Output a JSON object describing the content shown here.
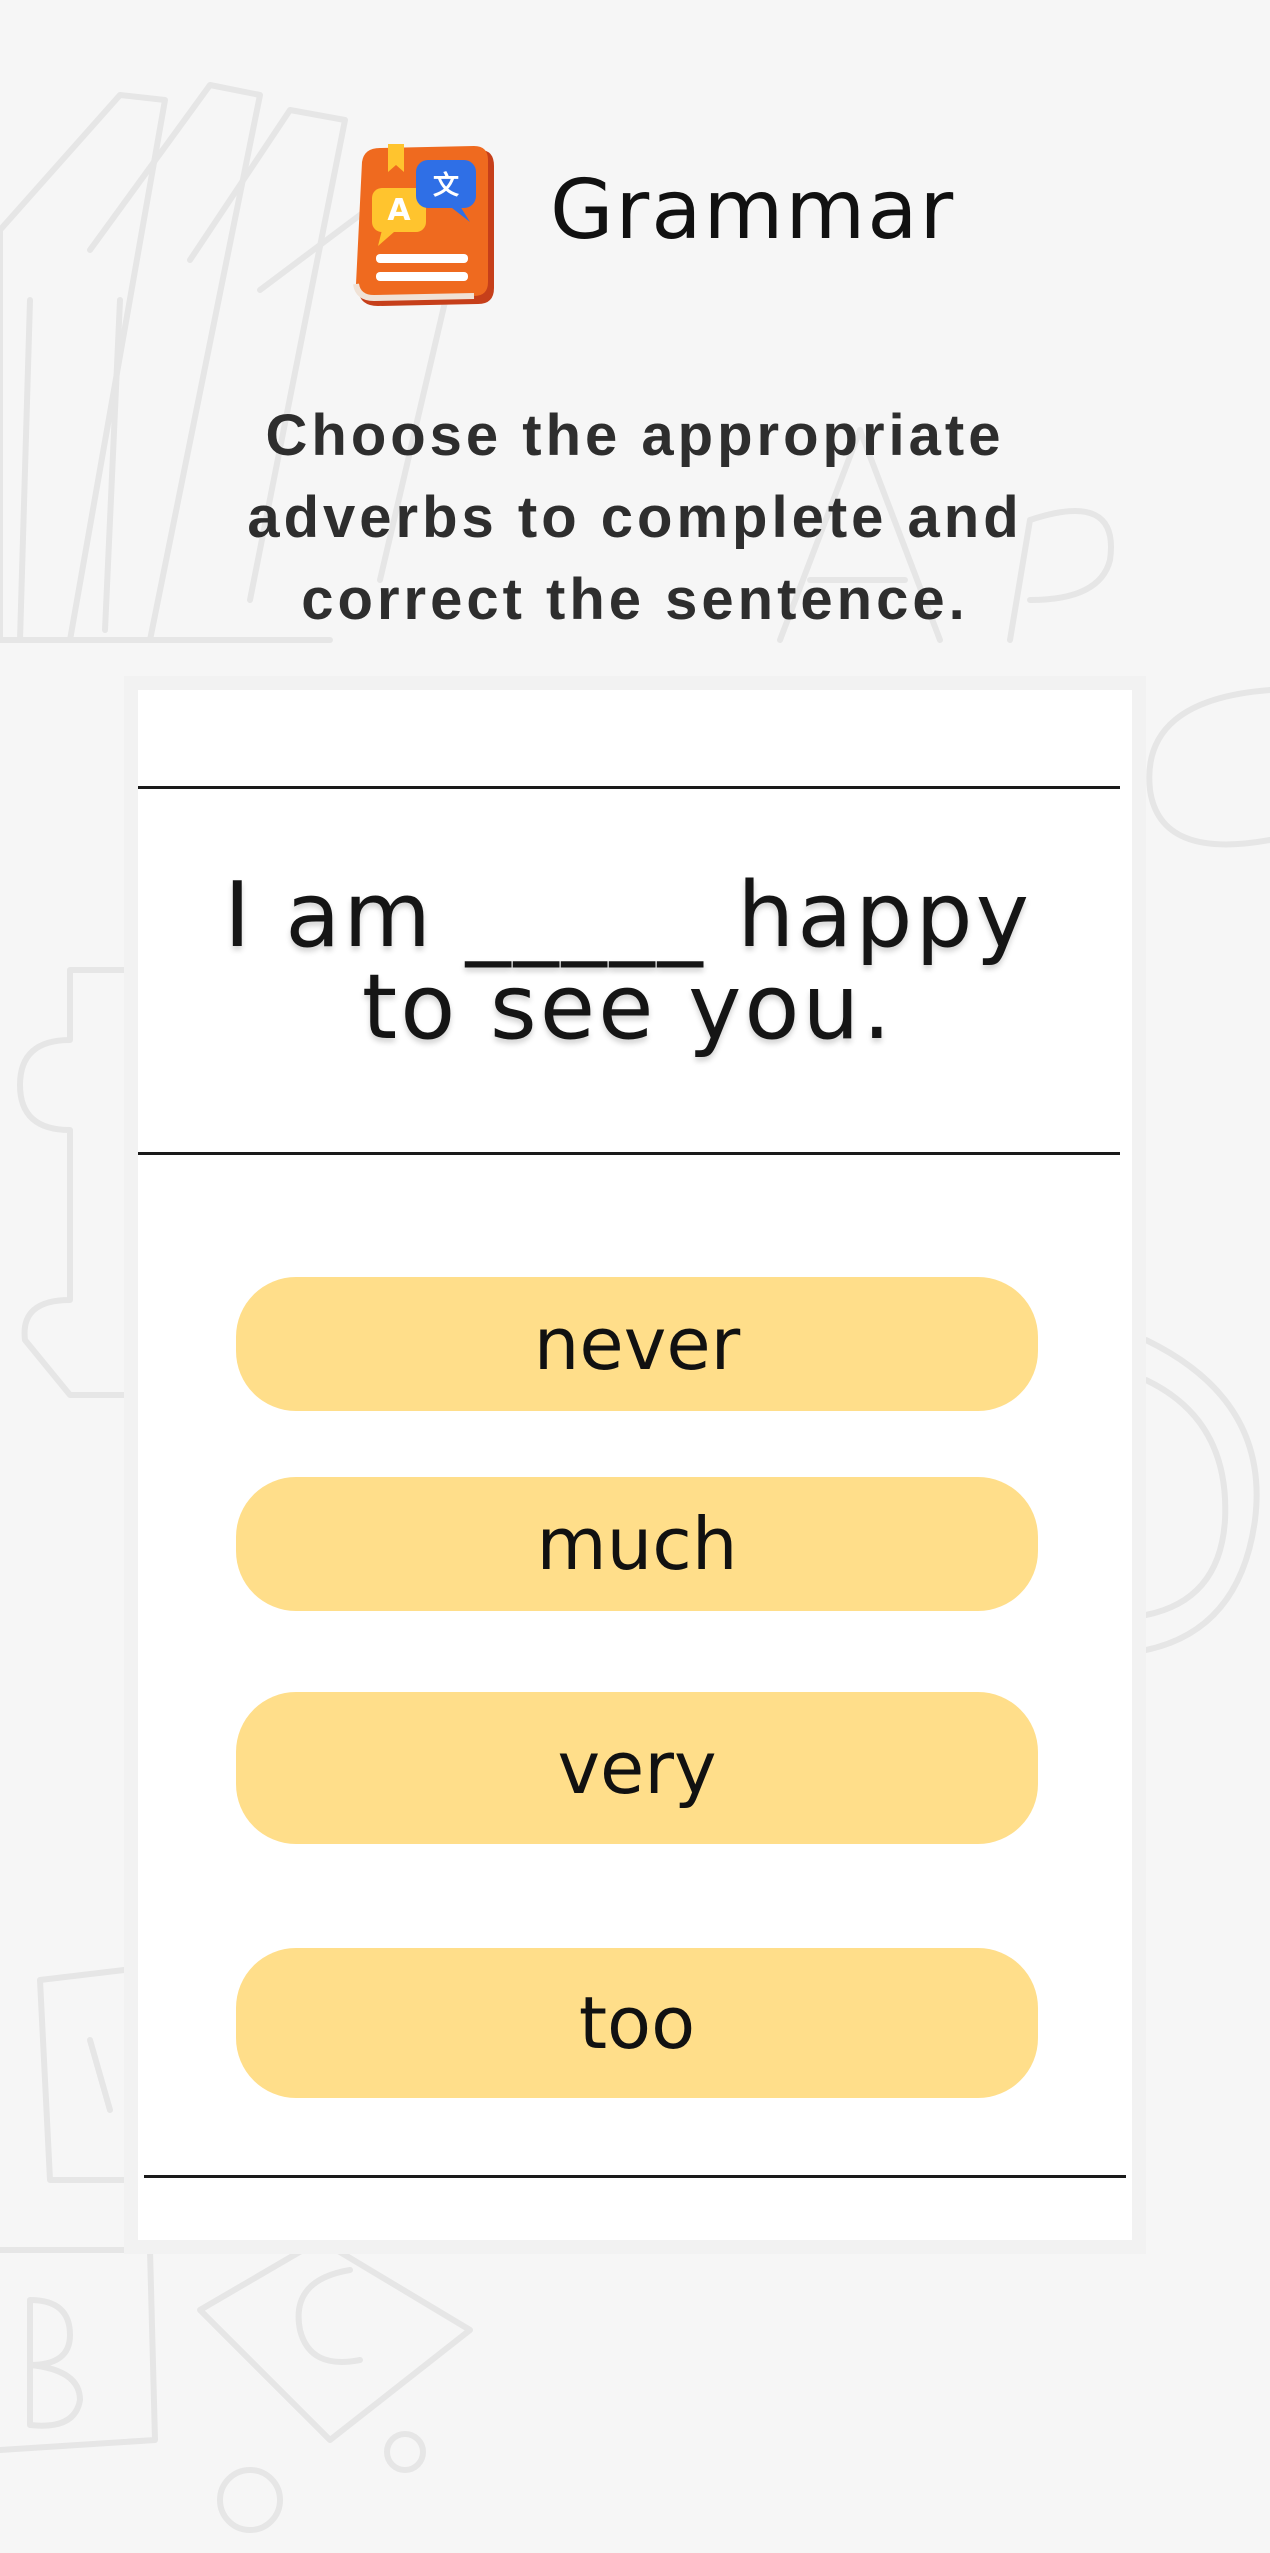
{
  "header": {
    "title": "Grammar",
    "icon": "grammar-book-icon"
  },
  "instructions": {
    "line1": "Choose the appropriate",
    "line2": "adverbs to complete and",
    "line3": "correct the sentence."
  },
  "question": {
    "line1": "I am _____ happy",
    "line2": "to see you."
  },
  "options": [
    {
      "label": "never"
    },
    {
      "label": "much"
    },
    {
      "label": "very"
    },
    {
      "label": "too"
    }
  ],
  "colors": {
    "background": "#f6f6f6",
    "card": "#ffffff",
    "option": "#ffde8a",
    "icon_orange": "#ef6a1f",
    "icon_blue": "#2f6fe6",
    "icon_yellow": "#ffc42e"
  }
}
